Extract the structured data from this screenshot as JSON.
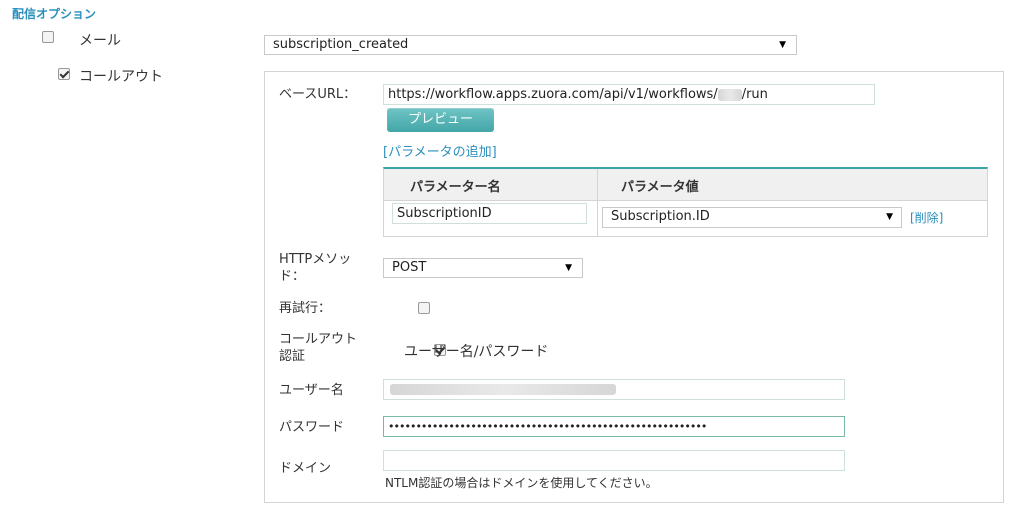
{
  "section": {
    "title": "配信オプション"
  },
  "options": {
    "email": {
      "label": "メール",
      "checked": false
    },
    "callout": {
      "label": "コールアウト",
      "checked": true
    }
  },
  "event_select": {
    "value": "subscription_created"
  },
  "form": {
    "base_url": {
      "label": "ベースURL：",
      "value_prefix": "https://workflow.apps.zuora.com/api/v1/workflows/",
      "value_suffix": "/run"
    },
    "preview_button": "プレビュー",
    "add_param_link": "[パラメータの追加]",
    "params_table": {
      "headers": [
        "パラメーター名",
        "パラメータ値"
      ],
      "rows": [
        {
          "name": "SubscriptionID",
          "value": "Subscription.ID",
          "delete": "[削除]"
        }
      ]
    },
    "http_method": {
      "label_line1": "HTTPメソッ",
      "label_line2": "ド：",
      "value": "POST"
    },
    "retry": {
      "label": "再試行：",
      "checked": false
    },
    "auth": {
      "label_line1": "コールアウト",
      "label_line2": "認証",
      "checked": true,
      "option": "ユーザー名/パスワード"
    },
    "username": {
      "label": "ユーザー名"
    },
    "password": {
      "label": "パスワード",
      "value": "••••••••••••••••••••••••••••••••••••••••••••••••••••••••••"
    },
    "domain": {
      "label": "ドメイン",
      "hint": "NTLM認証の場合はドメインを使用してください。"
    }
  }
}
